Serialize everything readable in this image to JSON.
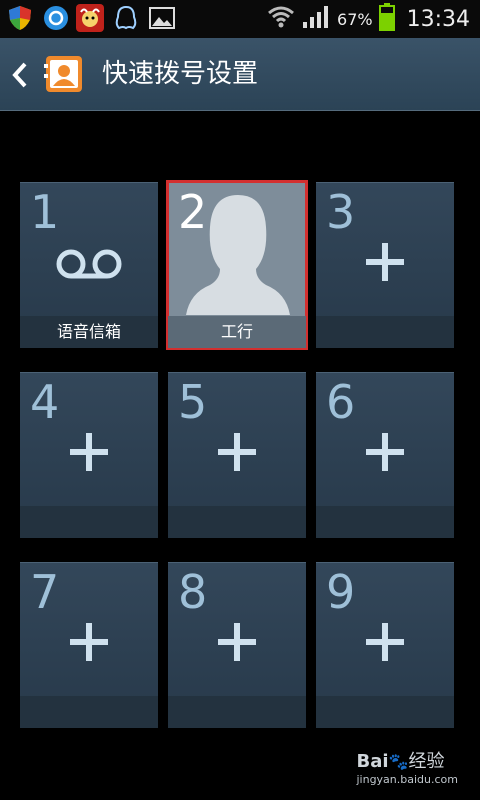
{
  "status_bar": {
    "battery_percent": "67%",
    "time": "13:34",
    "icons": [
      "shield-icon",
      "sync-icon",
      "ox-app-icon",
      "qq-penguin-icon",
      "gallery-icon",
      "wifi-icon",
      "signal-icon",
      "battery-icon"
    ]
  },
  "header": {
    "title": "快速拨号设置"
  },
  "tiles": [
    {
      "number": "1",
      "label": "语音信箱",
      "type": "voicemail"
    },
    {
      "number": "2",
      "label": "工行",
      "type": "contact"
    },
    {
      "number": "3",
      "label": "",
      "type": "add"
    },
    {
      "number": "4",
      "label": "",
      "type": "add"
    },
    {
      "number": "5",
      "label": "",
      "type": "add"
    },
    {
      "number": "6",
      "label": "",
      "type": "add"
    },
    {
      "number": "7",
      "label": "",
      "type": "add"
    },
    {
      "number": "8",
      "label": "",
      "type": "add"
    },
    {
      "number": "9",
      "label": "",
      "type": "add"
    }
  ],
  "watermark": {
    "brand": "Bai",
    "brand_cn": "经验",
    "url": "jingyan.baidu.com"
  },
  "colors": {
    "highlight": "#d32f2f",
    "tile": "#33475a",
    "number": "#9fc0d8"
  }
}
